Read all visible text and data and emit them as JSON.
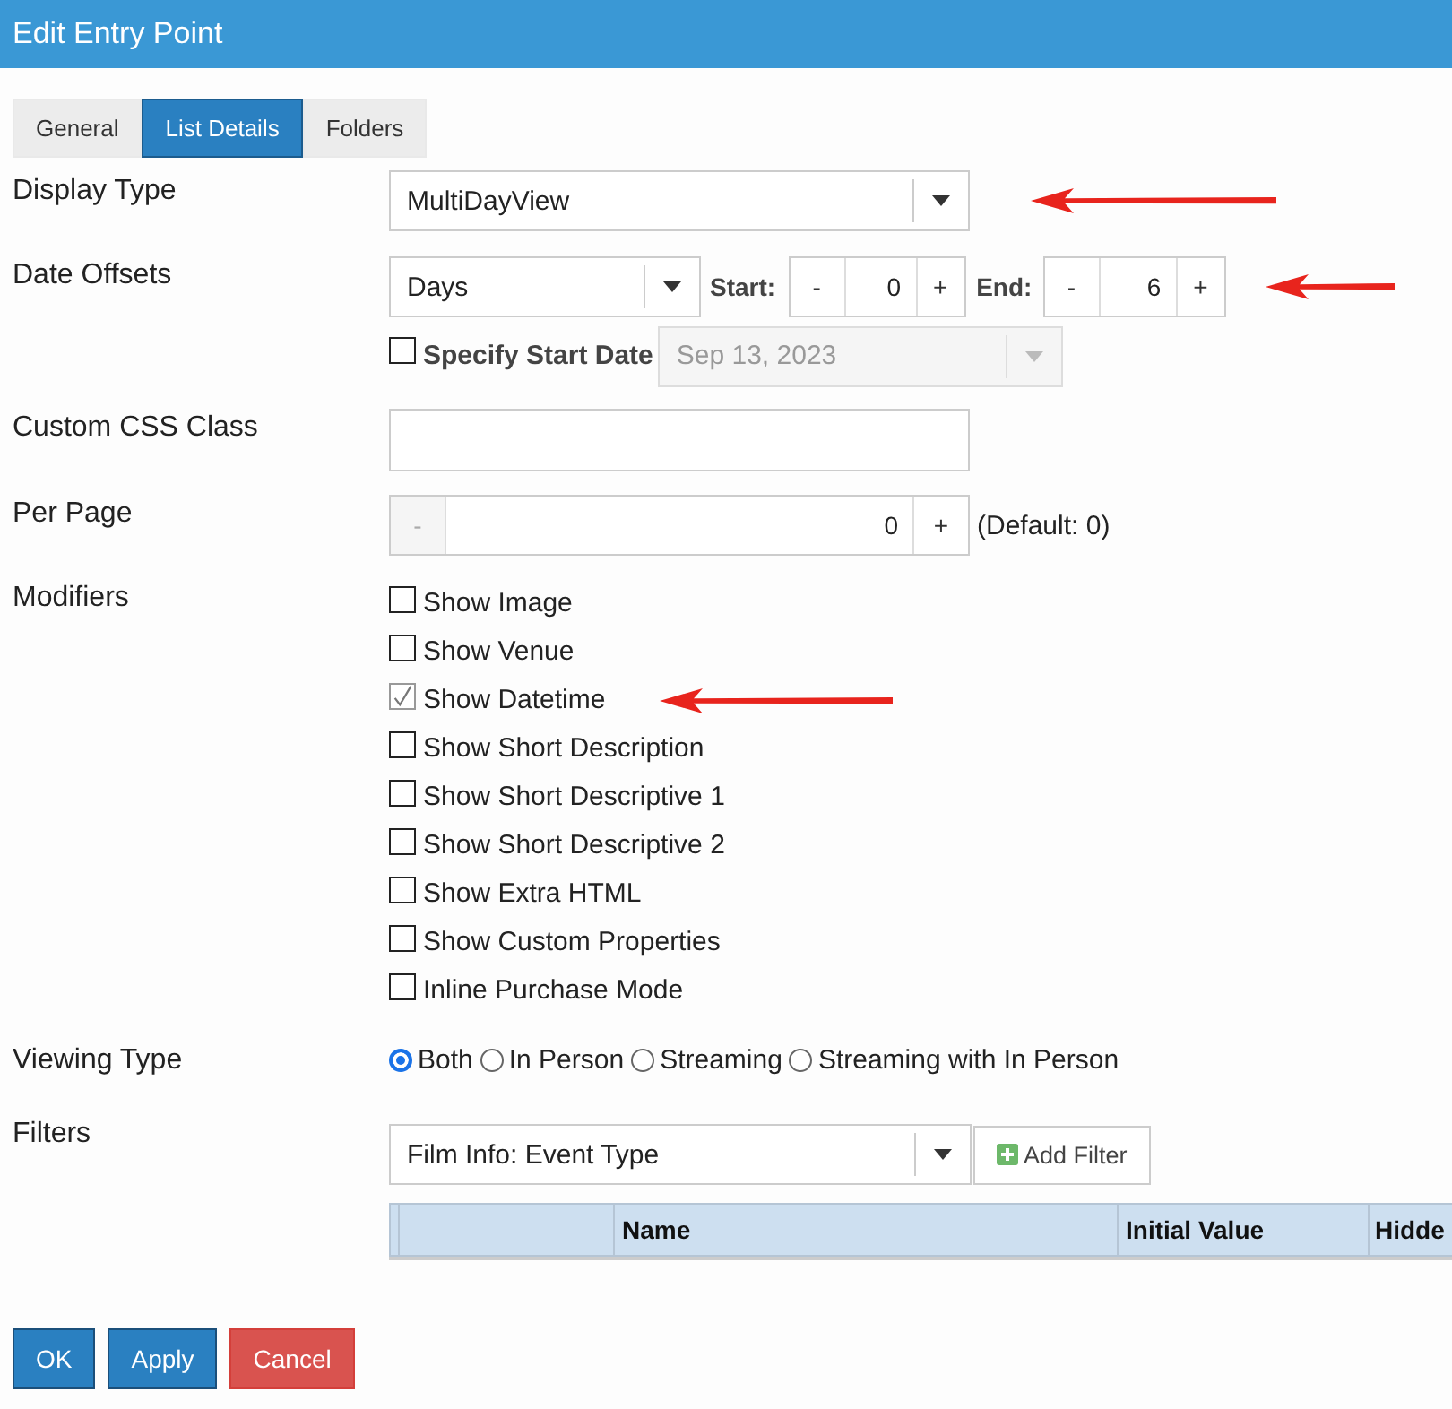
{
  "window": {
    "title": "Edit Entry Point"
  },
  "tabs": [
    {
      "label": "General",
      "selected": false
    },
    {
      "label": "List Details",
      "selected": true
    },
    {
      "label": "Folders",
      "selected": false
    }
  ],
  "display_type": {
    "label": "Display Type",
    "value": "MultiDayView",
    "arrow": true
  },
  "date_offsets": {
    "label": "Date Offsets",
    "unit": "Days",
    "start_label": "Start:",
    "start": {
      "minus": "-",
      "value": "0",
      "plus": "+"
    },
    "end_label": "End:",
    "end": {
      "minus": "-",
      "value": "6",
      "plus": "+"
    },
    "arrow": true,
    "specify_start_date": {
      "label": "Specify Start Date",
      "checked": false
    },
    "start_date": {
      "value": "Sep 13, 2023",
      "disabled": true
    }
  },
  "custom_css_class": {
    "label": "Custom CSS Class"
  },
  "per_page": {
    "label": "Per Page",
    "minus": "-",
    "minus_disabled": true,
    "value": "0",
    "plus": "+",
    "note": "(Default: 0)"
  },
  "modifiers": {
    "label": "Modifiers",
    "items": [
      {
        "label": "Show Image",
        "checked": false,
        "arrow": false
      },
      {
        "label": "Show Venue",
        "checked": false,
        "arrow": false
      },
      {
        "label": "Show Datetime",
        "checked": true,
        "arrow": true
      },
      {
        "label": "Show Short Description",
        "checked": false,
        "arrow": false
      },
      {
        "label": "Show Short Descriptive 1",
        "checked": false,
        "arrow": false
      },
      {
        "label": "Show Short Descriptive 2",
        "checked": false,
        "arrow": false
      },
      {
        "label": "Show Extra HTML",
        "checked": false,
        "arrow": false
      },
      {
        "label": "Show Custom Properties",
        "checked": false,
        "arrow": false
      },
      {
        "label": "Inline Purchase Mode",
        "checked": false,
        "arrow": false
      }
    ]
  },
  "viewing_type": {
    "label": "Viewing Type",
    "options": [
      {
        "label": "Both",
        "selected": true
      },
      {
        "label": "In Person",
        "selected": false
      },
      {
        "label": "Streaming",
        "selected": false
      },
      {
        "label": "Streaming with In Person",
        "selected": false
      }
    ]
  },
  "filters": {
    "label": "Filters",
    "field": "Film Info: Event Type",
    "add_button": "Add Filter",
    "columns": [
      "Name",
      "Initial Value",
      "Hidde"
    ]
  },
  "buttons": [
    {
      "label": "OK",
      "kind": "confirm"
    },
    {
      "label": "Apply",
      "kind": "apply"
    },
    {
      "label": "Cancel",
      "kind": "cancel"
    }
  ]
}
